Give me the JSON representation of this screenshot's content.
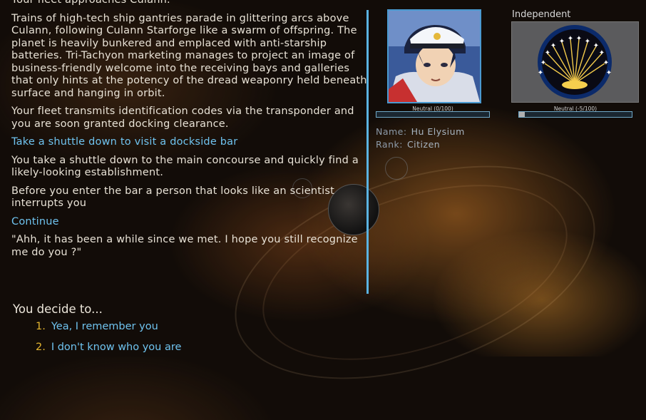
{
  "story": {
    "paragraphs": [
      "Your fleet approaches Culann.",
      "Trains of high-tech ship gantries parade in glittering arcs above Culann, following Culann Starforge like a swarm of offspring. The planet is heavily bunkered and emplaced with anti-starship batteries. Tri-Tachyon marketing manages to project an image of business-friendly welcome into the receiving bays and galleries that only hints at the potency of the dread weaponry held beneath surface and hanging in orbit.",
      "Your fleet transmits identification codes via the transponder and you are soon granted docking clearance.",
      "Take a shuttle down to visit a dockside bar",
      "You take a shuttle down to the main concourse and quickly find a likely-looking establishment.",
      "Before you enter the bar a person that looks like an scientist interrupts you",
      "Continue",
      "\"Ahh, it has been a while since we met. I hope you still recognize me do you ?\""
    ]
  },
  "character": {
    "portrait_icon": "character-portrait",
    "reputation_label": "Neutral (0/100)",
    "reputation_value": 0,
    "name_label": "Name:",
    "name_value": "Hu Elysium",
    "rank_label": "Rank:",
    "rank_value": "Citizen"
  },
  "faction": {
    "title": "Independent",
    "emblem_icon": "independent-emblem",
    "reputation_label": "Neutral (-5/100)",
    "reputation_value": -5
  },
  "decision": {
    "prompt": "You decide to...",
    "options": [
      {
        "num": "1.",
        "label": "Yea, I remember you"
      },
      {
        "num": "2.",
        "label": "I don't know who you are"
      }
    ]
  },
  "colors": {
    "accent": "#5ab3e2",
    "option_text": "#6fc3ef",
    "option_number": "#e5b630"
  }
}
